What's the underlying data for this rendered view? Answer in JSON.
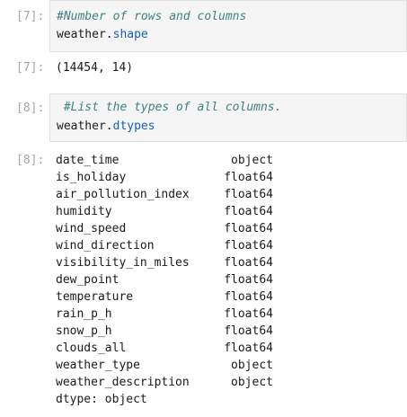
{
  "cells": [
    {
      "in_prompt": "[7]:",
      "comment": "#Number of rows and columns",
      "code_obj": "weather",
      "code_dot": ".",
      "code_attr": "shape",
      "out_prompt": "[7]:",
      "output": "(14454, 14)"
    },
    {
      "in_prompt": "[8]:",
      "comment": " #List the types of all columns.",
      "code_obj": "weather",
      "code_dot": ".",
      "code_attr": "dtypes",
      "out_prompt": "[8]:"
    }
  ],
  "dtypes": [
    {
      "col": "date_time",
      "type": "object"
    },
    {
      "col": "is_holiday",
      "type": "float64"
    },
    {
      "col": "air_pollution_index",
      "type": "float64"
    },
    {
      "col": "humidity",
      "type": "float64"
    },
    {
      "col": "wind_speed",
      "type": "float64"
    },
    {
      "col": "wind_direction",
      "type": "float64"
    },
    {
      "col": "visibility_in_miles",
      "type": "float64"
    },
    {
      "col": "dew_point",
      "type": "float64"
    },
    {
      "col": "temperature",
      "type": "float64"
    },
    {
      "col": "rain_p_h",
      "type": "float64"
    },
    {
      "col": "snow_p_h",
      "type": "float64"
    },
    {
      "col": "clouds_all",
      "type": "float64"
    },
    {
      "col": "weather_type",
      "type": "object"
    },
    {
      "col": "weather_description",
      "type": "object"
    }
  ],
  "dtype_footer": "dtype: object"
}
